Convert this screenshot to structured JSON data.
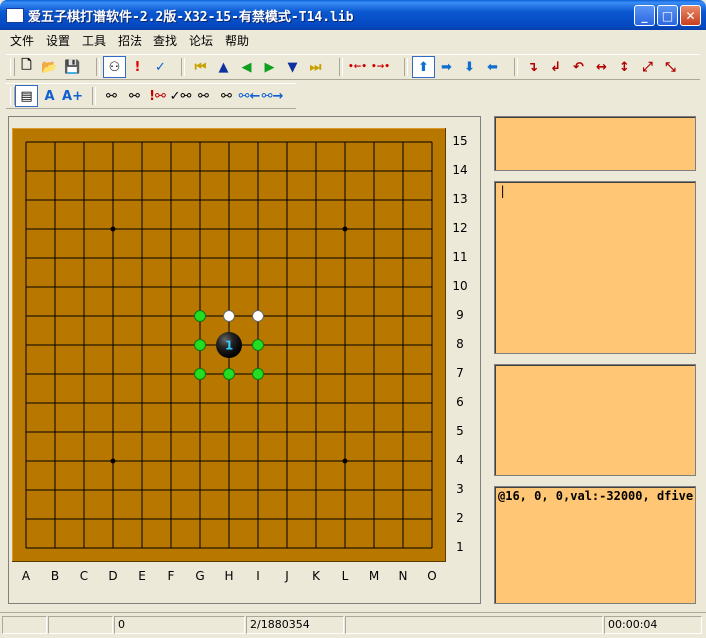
{
  "window": {
    "title": "爱五子棋打谱软件-2.2版-X32-15-有禁模式-T14.lib",
    "controls": {
      "minimize": "_",
      "maximize": "□",
      "close": "✕"
    }
  },
  "menu": [
    "文件",
    "设置",
    "工具",
    "招法",
    "查找",
    "论坛",
    "帮助"
  ],
  "toolbar1": [
    {
      "name": "new-file-icon",
      "glyph": "🗋",
      "color": "#000"
    },
    {
      "name": "open-folder-icon",
      "glyph": "📂",
      "color": "#b08000"
    },
    {
      "name": "save-disk-icon",
      "glyph": "💾",
      "color": "#888"
    },
    {
      "name": "stones-icon",
      "glyph": "⚇",
      "color": "#000",
      "pressed": true
    },
    {
      "name": "exclamation-icon",
      "glyph": "!",
      "color": "#e00000"
    },
    {
      "name": "checkmark-icon",
      "glyph": "✓",
      "color": "#1060d0"
    },
    {
      "name": "first-move-icon",
      "glyph": "⏮",
      "color": "#c8a000"
    },
    {
      "name": "arrow-up-icon",
      "glyph": "▲",
      "color": "#1030a0"
    },
    {
      "name": "arrow-left-icon",
      "glyph": "◀",
      "color": "#10a020"
    },
    {
      "name": "arrow-right-icon",
      "glyph": "▶",
      "color": "#10a020"
    },
    {
      "name": "arrow-down-icon",
      "glyph": "▼",
      "color": "#1030a0"
    },
    {
      "name": "last-move-icon",
      "glyph": "⏭",
      "color": "#c8a000"
    },
    {
      "name": "dot-arrow-left-icon",
      "glyph": "•←•",
      "color": "#d00000"
    },
    {
      "name": "dot-arrow-right-icon",
      "glyph": "•→•",
      "color": "#d00000"
    },
    {
      "name": "shift-up-icon",
      "glyph": "⬆",
      "color": "#1070d0",
      "pressed": true
    },
    {
      "name": "shift-right-icon",
      "glyph": "➡",
      "color": "#1070d0"
    },
    {
      "name": "shift-down-icon",
      "glyph": "⬇",
      "color": "#1070d0"
    },
    {
      "name": "shift-left-icon",
      "glyph": "⬅",
      "color": "#1070d0"
    },
    {
      "name": "rotate-cw-icon",
      "glyph": "↴",
      "color": "#b00000"
    },
    {
      "name": "rotate-ccw-icon",
      "glyph": "↲",
      "color": "#b00000"
    },
    {
      "name": "rotate-180-icon",
      "glyph": "↶",
      "color": "#b00000"
    },
    {
      "name": "flip-horizontal-icon",
      "glyph": "↔",
      "color": "#b00000"
    },
    {
      "name": "flip-vertical-icon",
      "glyph": "↕",
      "color": "#b00000"
    },
    {
      "name": "flip-diagonal-icon",
      "glyph": "⤢",
      "color": "#b00000"
    },
    {
      "name": "flip-antidiagonal-icon",
      "glyph": "⤡",
      "color": "#b00000"
    }
  ],
  "toolbar2": [
    {
      "name": "text-small-icon",
      "glyph": "▤",
      "color": "#000",
      "pressed": true
    },
    {
      "name": "text-medium-icon",
      "glyph": "A",
      "color": "#1060d0"
    },
    {
      "name": "text-large-icon",
      "glyph": "A+",
      "color": "#1060d0"
    },
    {
      "name": "search-binoculars-icon",
      "glyph": "⚯",
      "color": "#000"
    },
    {
      "name": "search-binoculars-2-icon",
      "glyph": "⚯",
      "color": "#000"
    },
    {
      "name": "search-exclaim-icon",
      "glyph": "!⚯",
      "color": "#c00000"
    },
    {
      "name": "search-check-icon",
      "glyph": "✓⚯",
      "color": "#000"
    },
    {
      "name": "search-next-icon",
      "glyph": "⚯",
      "color": "#000"
    },
    {
      "name": "search-all-icon",
      "glyph": "⚯",
      "color": "#000"
    },
    {
      "name": "search-back-icon",
      "glyph": "⚯←",
      "color": "#1060d0"
    },
    {
      "name": "search-forward-icon",
      "glyph": "⚯→",
      "color": "#1060d0"
    }
  ],
  "board": {
    "row_labels": [
      "15",
      "14",
      "13",
      "12",
      "11",
      "10",
      "9",
      "8",
      "7",
      "6",
      "5",
      "4",
      "3",
      "2",
      "1"
    ],
    "col_labels": [
      "A",
      "B",
      "C",
      "D",
      "E",
      "F",
      "G",
      "H",
      "I",
      "J",
      "K",
      "L",
      "M",
      "N",
      "O"
    ],
    "star_points": [
      "D12",
      "L12",
      "D4",
      "L4"
    ],
    "black_stones": [
      {
        "pos": "H8",
        "label": "1"
      }
    ],
    "white_marks": [
      "H9",
      "I9"
    ],
    "green_marks": [
      "G9",
      "G8",
      "I8",
      "G7",
      "H7",
      "I7"
    ]
  },
  "info_panels": {
    "panel1": "",
    "panel2": "|",
    "panel3": "",
    "panel4": "@16,  0,   0,val:-32000, dfive 0"
  },
  "status": {
    "cell1": "",
    "cell2": "0",
    "cell3": "2/1880354",
    "cell4": "",
    "cell5": "00:00:04"
  }
}
